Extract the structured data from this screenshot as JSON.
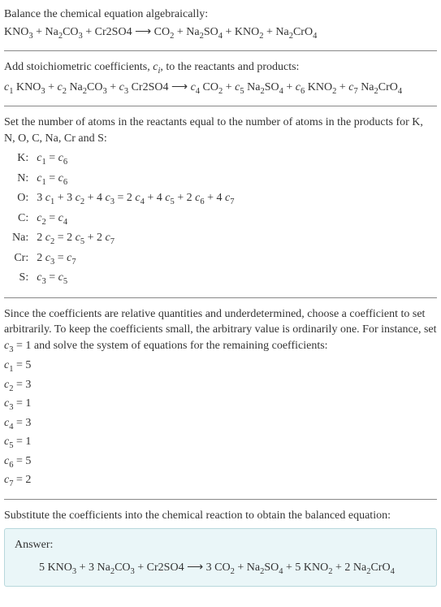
{
  "intro": {
    "line1": "Balance the chemical equation algebraically:",
    "eq_left": "KNO<sub>3</sub> + Na<sub>2</sub>CO<sub>3</sub> + Cr2SO4",
    "arrow": "⟶",
    "eq_right": "CO<sub>2</sub> + Na<sub>2</sub>SO<sub>4</sub> + KNO<sub>2</sub> + Na<sub>2</sub>CrO<sub>4</sub>"
  },
  "stoich": {
    "text": "Add stoichiometric coefficients, <span class=\"ital\">c<sub>i</sub></span>, to the reactants and products:",
    "eq": "<span class=\"ital\">c</span><sub>1</sub> KNO<sub>3</sub> + <span class=\"ital\">c</span><sub>2</sub> Na<sub>2</sub>CO<sub>3</sub> + <span class=\"ital\">c</span><sub>3</sub> Cr2SO4 ⟶ <span class=\"ital\">c</span><sub>4</sub> CO<sub>2</sub> + <span class=\"ital\">c</span><sub>5</sub> Na<sub>2</sub>SO<sub>4</sub> + <span class=\"ital\">c</span><sub>6</sub> KNO<sub>2</sub> + <span class=\"ital\">c</span><sub>7</sub> Na<sub>2</sub>CrO<sub>4</sub>"
  },
  "atoms": {
    "text": "Set the number of atoms in the reactants equal to the number of atoms in the products for K, N, O, C, Na, Cr and S:",
    "rows": [
      {
        "label": "K:",
        "eq": "<span class=\"ital\">c</span><sub>1</sub> = <span class=\"ital\">c</span><sub>6</sub>"
      },
      {
        "label": "N:",
        "eq": "<span class=\"ital\">c</span><sub>1</sub> = <span class=\"ital\">c</span><sub>6</sub>"
      },
      {
        "label": "O:",
        "eq": "3 <span class=\"ital\">c</span><sub>1</sub> + 3 <span class=\"ital\">c</span><sub>2</sub> + 4 <span class=\"ital\">c</span><sub>3</sub> = 2 <span class=\"ital\">c</span><sub>4</sub> + 4 <span class=\"ital\">c</span><sub>5</sub> + 2 <span class=\"ital\">c</span><sub>6</sub> + 4 <span class=\"ital\">c</span><sub>7</sub>"
      },
      {
        "label": "C:",
        "eq": "<span class=\"ital\">c</span><sub>2</sub> = <span class=\"ital\">c</span><sub>4</sub>"
      },
      {
        "label": "Na:",
        "eq": "2 <span class=\"ital\">c</span><sub>2</sub> = 2 <span class=\"ital\">c</span><sub>5</sub> + 2 <span class=\"ital\">c</span><sub>7</sub>"
      },
      {
        "label": "Cr:",
        "eq": "2 <span class=\"ital\">c</span><sub>3</sub> = <span class=\"ital\">c</span><sub>7</sub>"
      },
      {
        "label": "S:",
        "eq": "<span class=\"ital\">c</span><sub>3</sub> = <span class=\"ital\">c</span><sub>5</sub>"
      }
    ]
  },
  "underdet": {
    "text": "Since the coefficients are relative quantities and underdetermined, choose a coefficient to set arbitrarily. To keep the coefficients small, the arbitrary value is ordinarily one. For instance, set <span class=\"ital\">c</span><sub>3</sub> = 1 and solve the system of equations for the remaining coefficients:",
    "coefs": [
      "<span class=\"ital\">c</span><sub>1</sub> = 5",
      "<span class=\"ital\">c</span><sub>2</sub> = 3",
      "<span class=\"ital\">c</span><sub>3</sub> = 1",
      "<span class=\"ital\">c</span><sub>4</sub> = 3",
      "<span class=\"ital\">c</span><sub>5</sub> = 1",
      "<span class=\"ital\">c</span><sub>6</sub> = 5",
      "<span class=\"ital\">c</span><sub>7</sub> = 2"
    ]
  },
  "substitute": {
    "text": "Substitute the coefficients into the chemical reaction to obtain the balanced equation:"
  },
  "answer": {
    "label": "Answer:",
    "eq": "5 KNO<sub>3</sub> + 3 Na<sub>2</sub>CO<sub>3</sub> + Cr2SO4 ⟶ 3 CO<sub>2</sub> + Na<sub>2</sub>SO<sub>4</sub> + 5 KNO<sub>2</sub> + 2 Na<sub>2</sub>CrO<sub>4</sub>"
  }
}
